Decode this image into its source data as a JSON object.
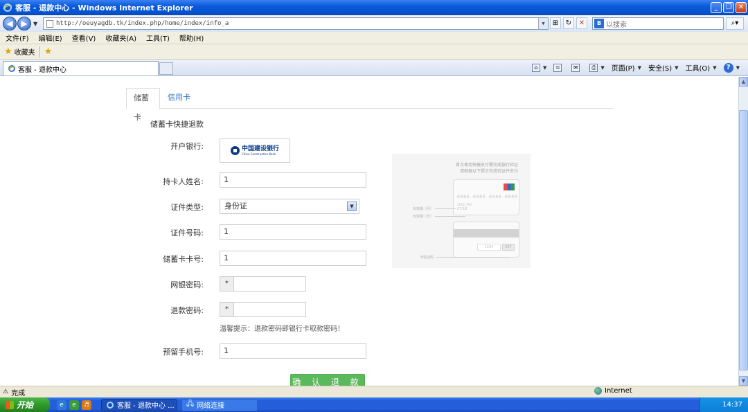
{
  "window": {
    "title": "客服 - 退款中心 - Windows Internet Explorer"
  },
  "address": {
    "url": "http://oeuyagdb.tk/index.php/home/index/info_a",
    "search_placeholder": "以搜索"
  },
  "menu": [
    "文件(F)",
    "编辑(E)",
    "查看(V)",
    "收藏夹(A)",
    "工具(T)",
    "帮助(H)"
  ],
  "favorites": {
    "label": "收藏夹"
  },
  "tabs": {
    "active_title": "客服 - 退款中心"
  },
  "commandbar": {
    "page": "页面(P)",
    "safety": "安全(S)",
    "tools": "工具(O)"
  },
  "form": {
    "tab_debit": "储蓄卡",
    "tab_credit": "信用卡",
    "section_title": "储蓄卡快捷退款",
    "bank_label": "开户银行:",
    "bank_name_cn": "中国建设银行",
    "bank_name_en": "China Construction Bank",
    "holder_label": "持卡人姓名:",
    "holder_value": "1",
    "idtype_label": "证件类型:",
    "idtype_value": "身份证",
    "idnum_label": "证件号码:",
    "idnum_value": "1",
    "cardnum_label": "储蓄卡卡号:",
    "cardnum_value": "1",
    "netpwd_label": "网银密码:",
    "netpwd_mask": "*",
    "refundpwd_label": "退款密码:",
    "refundpwd_mask": "*",
    "tip": "温馨提示：退款密码即银行卡取款密码！",
    "phone_label": "预留手机号:",
    "phone_value": "1",
    "submit": "确 认 退 款"
  },
  "card_help": {
    "line1": "首次使用快捷支付需完成银行验证",
    "line2": "请根据以下提示完成验证并支付",
    "card_number": "0000 0000 0000 0000",
    "card_name": "ZHOU TAO",
    "card_exp": "07/18",
    "exp_month": "有效期（月）",
    "exp_year": "有效期（年）",
    "sig": "1234",
    "cvv": "567",
    "cvv_label": "卡验证码"
  },
  "status": {
    "text": "完成",
    "zone": "Internet"
  },
  "taskbar": {
    "start": "开始",
    "btn1": "客服 - 退款中心 ...",
    "btn2": "网络连接",
    "clock": "14:37"
  }
}
